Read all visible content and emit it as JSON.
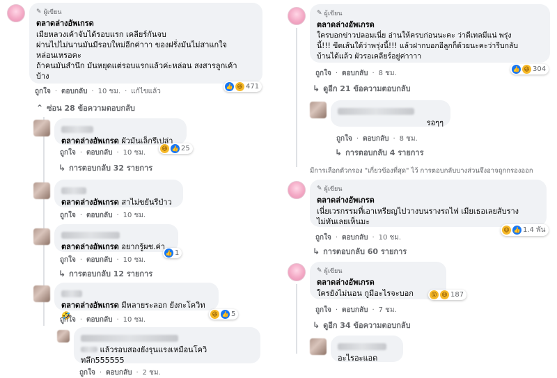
{
  "author_tag": "ผู้เขียน",
  "author_name": "ตลาดล่างอัพเกรด",
  "like_label": "ถูกใจ",
  "reply_label": "ตอบกลับ",
  "left": {
    "main": {
      "lines": [
        "เมียหลวงเค้าจับได้รอบแรก เคลียร์กันจบ",
        "ผ่านไปไม่นานมันมีรอบใหม่อีกค่าาา ของฝรั่งมันไม่สาแกใจ",
        "หล่อนเหรอคะ",
        "ถ้าคนมันสำนึก มันหยุดแต่รอบแรกแล้วค่ะหล่อน สงสารลูกเค้า",
        "บ้าง"
      ],
      "time": "10 ชม.",
      "edited": "แก้ไขแล้ว",
      "reaction_count": "471",
      "hide_replies": "ซ่อน 28 ข้อความตอบกลับ"
    },
    "replies": [
      {
        "text": "ผัวมันเล็กรึเปล่า",
        "time": "10 ชม.",
        "reaction_count": "25",
        "replies_label": "การตอบกลับ 32 รายการ"
      },
      {
        "text": "สาไม่ขยันรีป่าว",
        "time": "10 ชม."
      },
      {
        "text": "อยากรู้ผช.ค่า",
        "time": "10 ชม.",
        "reaction_count": "1",
        "replies_label": "การตอบกลับ 12 รายการ"
      },
      {
        "text": "มีหลายระลอก ยังกะโควิท 🤣",
        "time": "10 ชม.",
        "reaction_count": "5"
      }
    ],
    "last": {
      "lines": [
        "แล้วรอบสองยังรุนแรงเหมือนโควิ",
        "ทลึก555555"
      ],
      "time": "2 ชม."
    }
  },
  "right": {
    "main": {
      "lines": [
        "ใครบอกข่าวปลอมเนี่ย อ่านให้ครบก่อนนะคะ ว่าดีเทลมีแน่ พรุ่ง",
        "นี้!!! ขีดเส้นใต้ว่าพรุ่งนี้!!! แล้วฝากบอกอีลูกก็ด้วยนะคะว่ารีบกลับ",
        "บ้านได้แล้ว ผัวรอเคลียร์อยู่ค่าาาา"
      ],
      "time": "8 ชม.",
      "reaction_count": "304",
      "view_replies": "ดูอีก 21 ข้อความตอบกลับ"
    },
    "reply1": {
      "text": "รอๆๆ",
      "time": "8 ชม.",
      "replies_label": "การตอบกลับ 4 รายการ"
    },
    "filter_note": "มีการเลือกตัวกรอง \"เกี่ยวข้องที่สุด\" ไว้ การตอบกลับบางส่วนจึงอาจถูกกรองออก",
    "main2": {
      "lines": [
        "เนี่ยเวรกรรมที่เอาเหรียญไปวางบนรางรถไฟ เมียเธอเลยสับราง",
        "ไม่ทันเลยเห็นมะ"
      ],
      "time": "10 ชม.",
      "reaction_count": "1.4 พัน",
      "replies_label": "การตอบกลับ 60 รายการ"
    },
    "main3": {
      "text": "ใครยังไม่นอน กูมีอะไรจะบอก",
      "time": "7 ชม.",
      "reaction_count": "187",
      "view_replies": "ดูอีก 34 ข้อความตอบกลับ"
    },
    "reply3": {
      "text": "อะไรอะแอด"
    }
  }
}
